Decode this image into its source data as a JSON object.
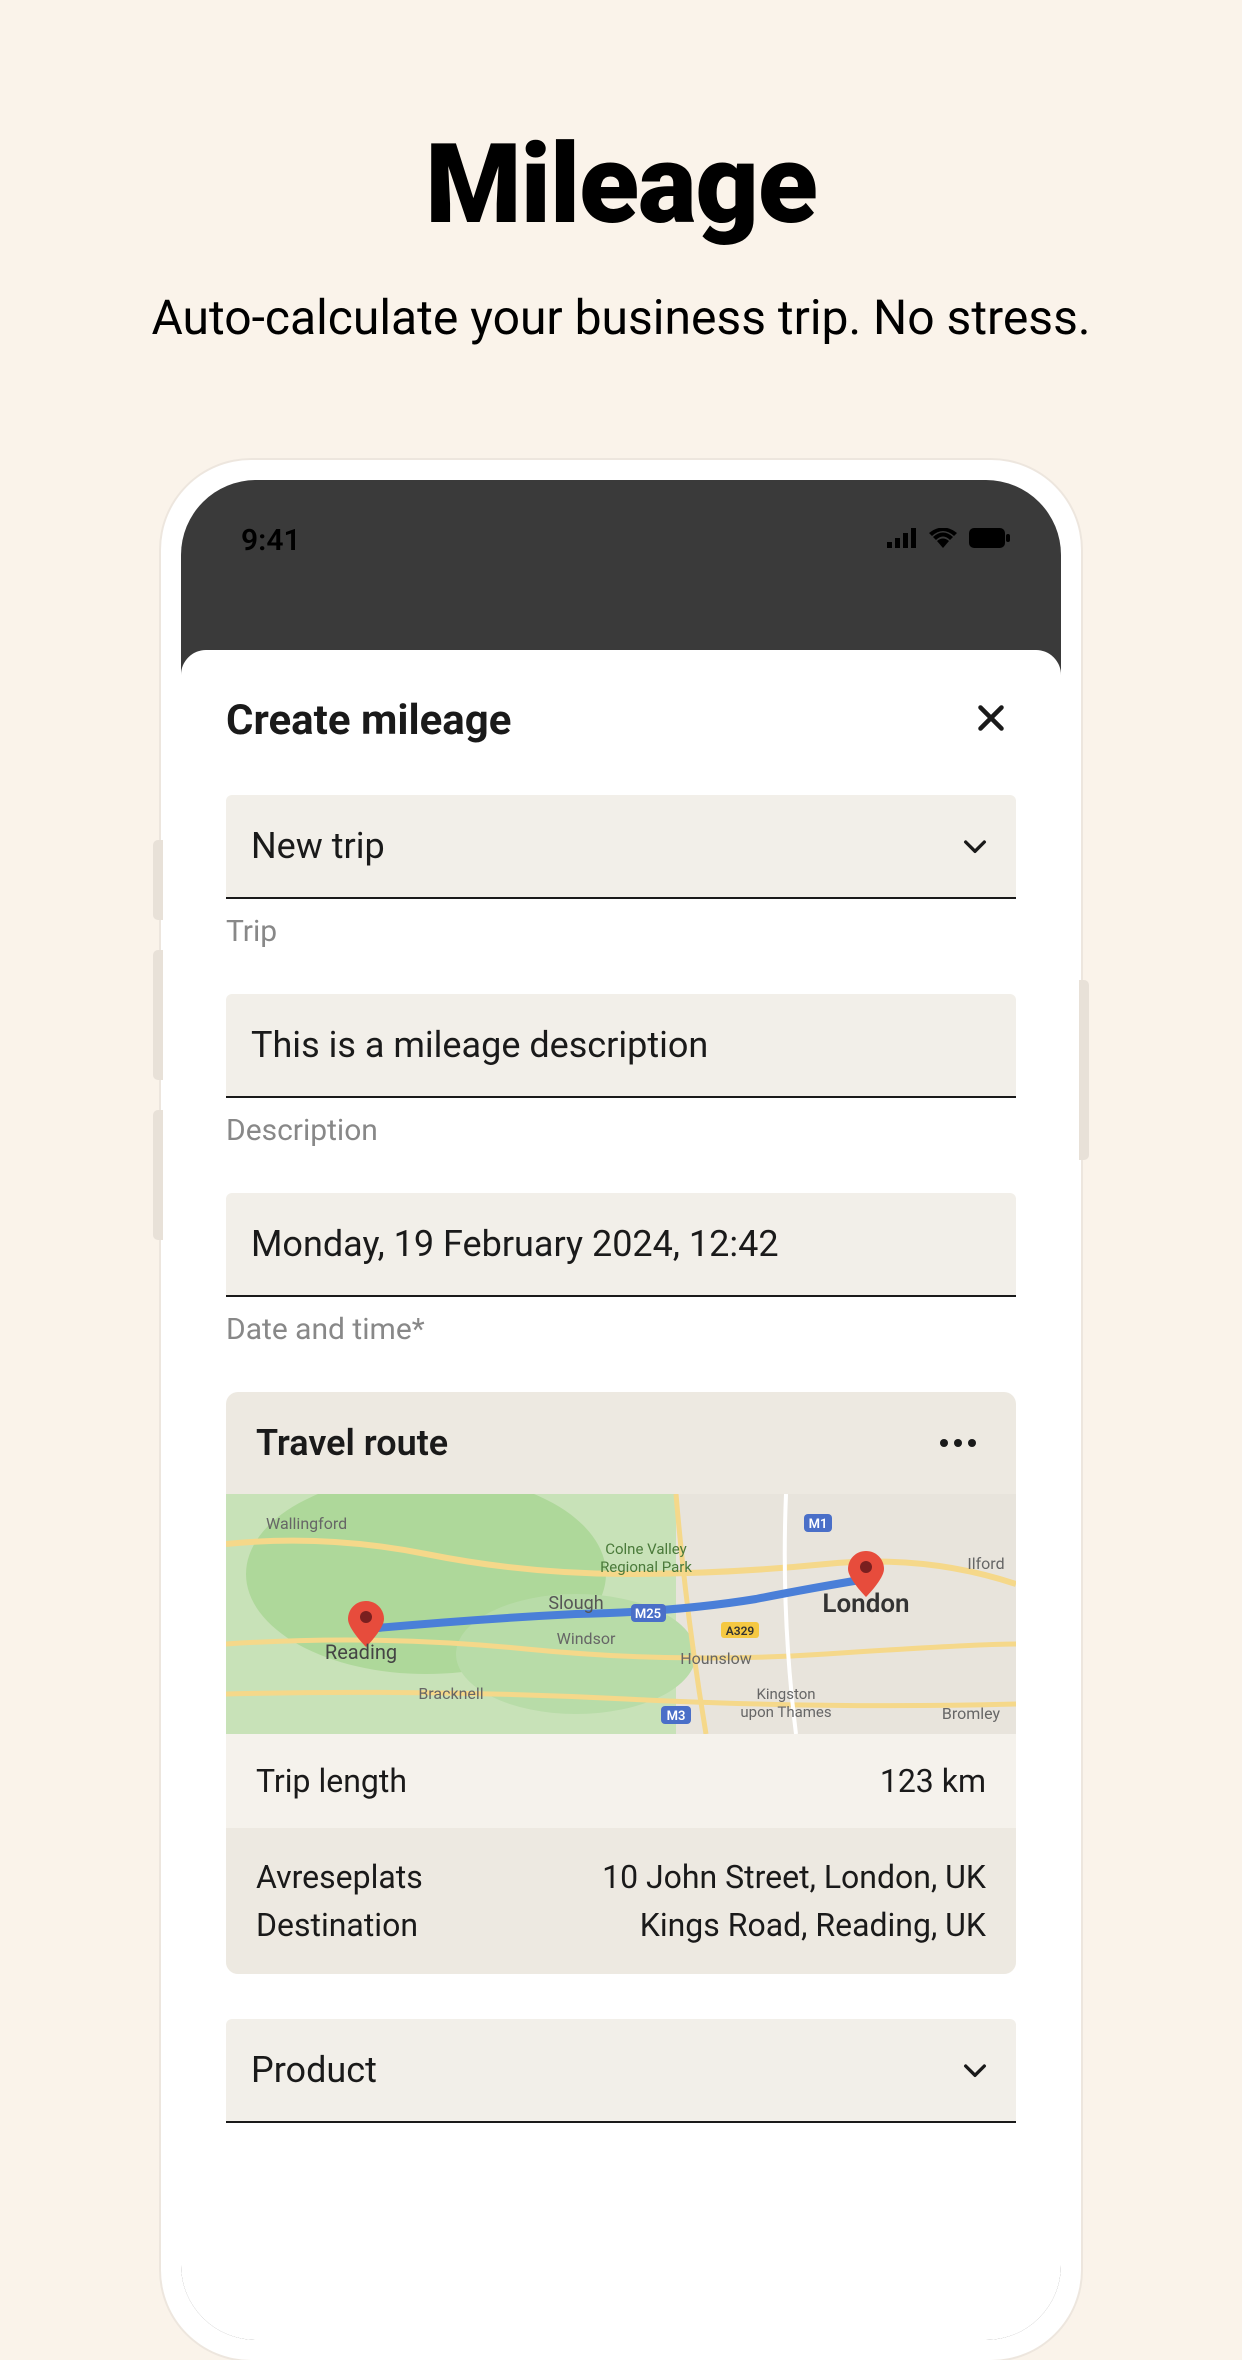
{
  "header": {
    "title": "Mileage",
    "subtitle": "Auto-calculate your business trip. No stress."
  },
  "statusBar": {
    "time": "9:41"
  },
  "modal": {
    "title": "Create mileage"
  },
  "form": {
    "trip": {
      "value": "New trip",
      "label": "Trip"
    },
    "description": {
      "value": "This is a mileage description",
      "label": "Description"
    },
    "datetime": {
      "value": "Monday, 19 February 2024, 12:42",
      "label": "Date and time*"
    },
    "product": {
      "value": "Product"
    }
  },
  "travelRoute": {
    "title": "Travel route",
    "tripLength": {
      "label": "Trip length",
      "value": "123 km"
    },
    "departure": {
      "label": "Avreseplats",
      "value": "10 John Street, London, UK"
    },
    "destination": {
      "label": "Destination",
      "value": "Kings Road, Reading, UK"
    },
    "mapLabels": {
      "london": "London",
      "reading": "Reading",
      "slough": "Slough",
      "windsor": "Windsor",
      "hounslow": "Hounslow",
      "bracknell": "Bracknell",
      "wallingford": "Wallingford",
      "bromley": "Bromley",
      "ilford": "Ilford",
      "kingston": "Kingston",
      "thames": "upon Thames",
      "colne": "Colne Valley",
      "regional": "Regional Park",
      "m25": "M25",
      "m3": "M3",
      "m1": "M1",
      "a329": "A329"
    }
  }
}
